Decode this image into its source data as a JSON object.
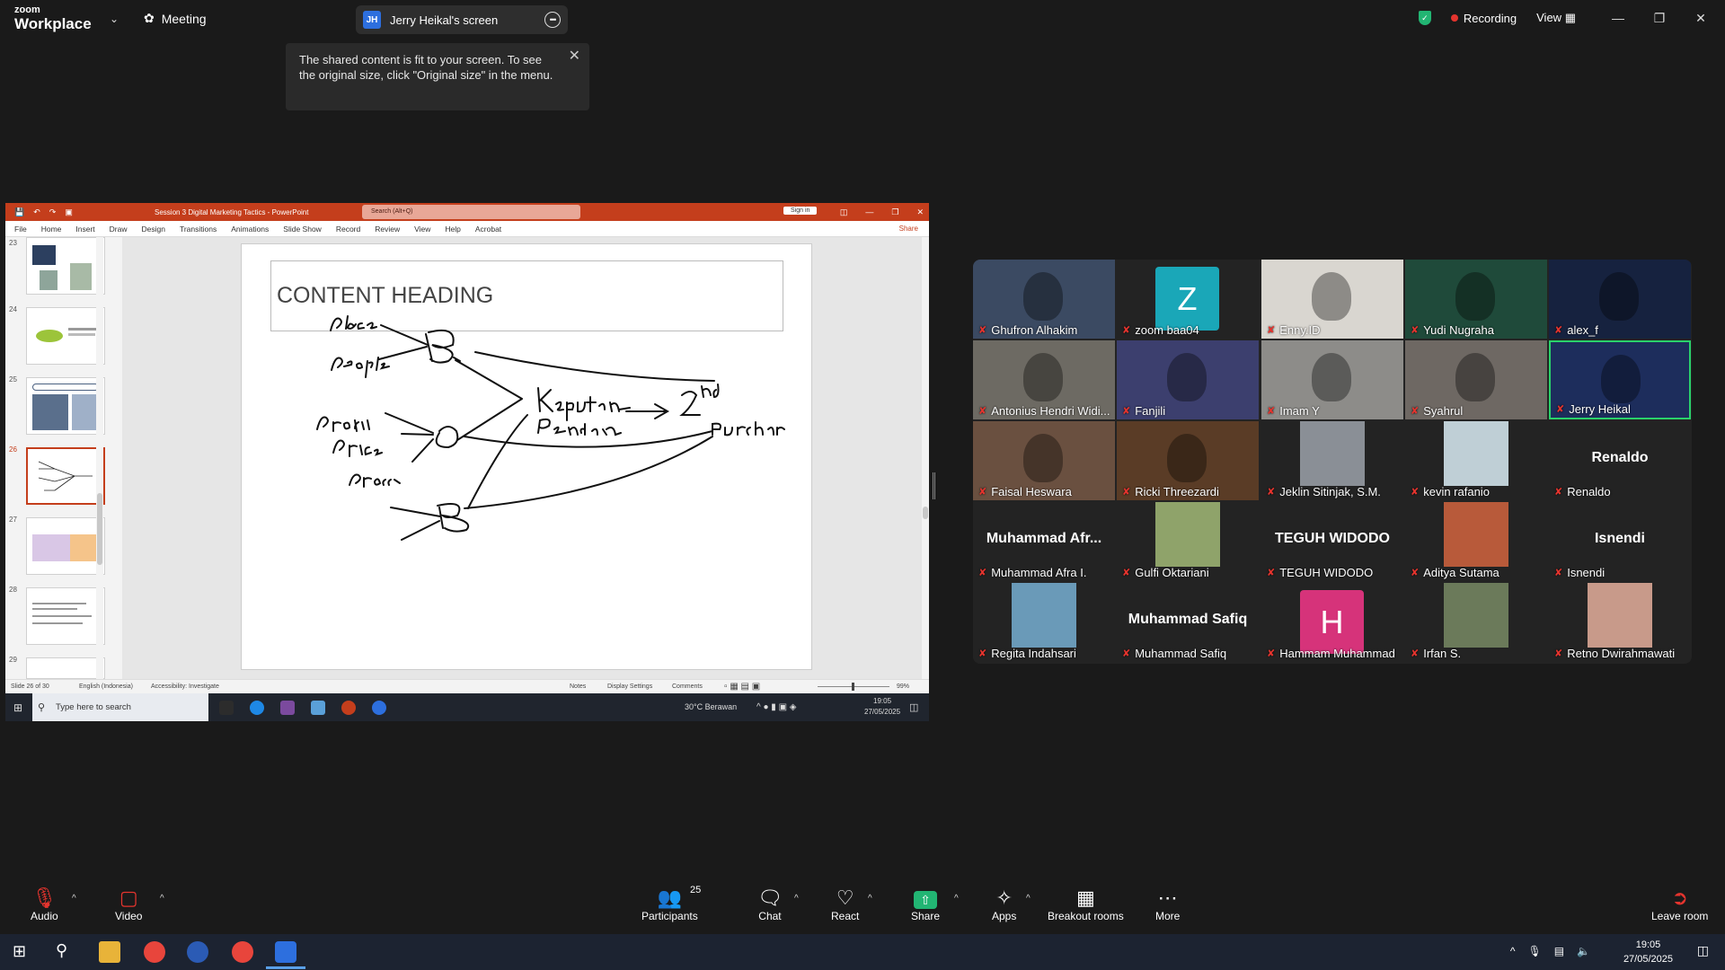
{
  "zoom": {
    "logo_top": "zoom",
    "logo_bottom": "Workplace",
    "meeting_label": "Meeting",
    "share_pill": {
      "initials": "JH",
      "label": "Jerry Heikal's screen"
    },
    "recording_label": "Recording",
    "view_label": "View",
    "tooltip_text": "The shared content is fit to your screen. To see the original size, click \"Original size\" in the menu."
  },
  "powerpoint": {
    "doc_title": "Session 3 Digital Marketing Tactics  -  PowerPoint",
    "search_placeholder": "Search (Alt+Q)",
    "sign_in": "Sign in",
    "share": "Share",
    "ribbon_tabs": [
      "File",
      "Home",
      "Insert",
      "Draw",
      "Design",
      "Transitions",
      "Animations",
      "Slide Show",
      "Record",
      "Review",
      "View",
      "Help",
      "Acrobat"
    ],
    "slide_numbers": [
      "23",
      "24",
      "25",
      "26",
      "27",
      "28",
      "29"
    ],
    "slide_heading": "CONTENT HEADING",
    "status": {
      "slide_of": "Slide 26 of 30",
      "language": "English (Indonesia)",
      "accessibility": "Accessibility: Investigate",
      "notes": "Notes",
      "display": "Display Settings",
      "comments": "Comments",
      "zoom": "99%"
    },
    "taskbar": {
      "search": "Type here to search",
      "weather": "30°C  Berawan",
      "time": "19:05",
      "date": "27/05/2025"
    }
  },
  "participants_grid": [
    {
      "name": "Ghufron Alhakim",
      "type": "video",
      "bg": "#3b4a62"
    },
    {
      "name": "zoom baa04",
      "type": "letter",
      "letter": "Z",
      "color": "#1aa7b8"
    },
    {
      "name": "Enny.ID",
      "type": "video",
      "bg": "#d9d6d0"
    },
    {
      "name": "Yudi Nugraha",
      "type": "video",
      "bg": "#1f4a3a"
    },
    {
      "name": "alex_f",
      "type": "video",
      "bg": "#16223f"
    },
    {
      "name": "Antonius Hendri Widi...",
      "type": "video",
      "bg": "#6d6a63"
    },
    {
      "name": "Fanjili",
      "type": "video",
      "bg": "#3c3f6e"
    },
    {
      "name": "Imam Y",
      "type": "video",
      "bg": "#8d8c89"
    },
    {
      "name": "Syahrul",
      "type": "video",
      "bg": "#6e6863"
    },
    {
      "name": "Jerry Heikal",
      "type": "video",
      "bg": "#1d2d5c",
      "active": true
    },
    {
      "name": "Faisal Heswara",
      "type": "video",
      "bg": "#6a5040"
    },
    {
      "name": "Ricki Threezardi",
      "type": "video",
      "bg": "#5a3c26"
    },
    {
      "name": "Jeklin Sitinjak, S.M.",
      "type": "photo",
      "bg": "#8a8f96"
    },
    {
      "name": "kevin rafanio",
      "type": "photo",
      "bg": "#bfcfd6"
    },
    {
      "name": "Renaldo",
      "type": "text",
      "big": "Renaldo"
    },
    {
      "name": "Muhammad Afra I.",
      "type": "text",
      "big": "Muhammad  Afr..."
    },
    {
      "name": "Gulfi Oktariani",
      "type": "photo",
      "bg": "#8fa36a"
    },
    {
      "name": "TEGUH WIDODO",
      "type": "text",
      "big": "TEGUH WIDODO"
    },
    {
      "name": "Aditya Sutama",
      "type": "photo",
      "bg": "#b85a3a"
    },
    {
      "name": "Isnendi",
      "type": "text",
      "big": "Isnendi"
    },
    {
      "name": "Regita Indahsari",
      "type": "photo",
      "bg": "#6a9ab8"
    },
    {
      "name": "Muhammad Safiq",
      "type": "text",
      "big": "Muhammad Safiq"
    },
    {
      "name": "Hammam Muhammad",
      "type": "letter",
      "letter": "H",
      "color": "#d6337a"
    },
    {
      "name": "Irfan S.",
      "type": "photo",
      "bg": "#6b7a5a"
    },
    {
      "name": "Retno Dwirahmawati",
      "type": "photo",
      "bg": "#c89a8a"
    }
  ],
  "toolbar": {
    "audio": "Audio",
    "video": "Video",
    "participants": "Participants",
    "participant_count": "25",
    "chat": "Chat",
    "react": "React",
    "share": "Share",
    "apps": "Apps",
    "breakout": "Breakout rooms",
    "more": "More",
    "leave": "Leave room"
  },
  "windows": {
    "time": "19:05",
    "date": "27/05/2025"
  },
  "colors": {
    "accent_green": "#2ad26b",
    "recording_red": "#e5342e",
    "powerpoint_red": "#c43e1c"
  }
}
